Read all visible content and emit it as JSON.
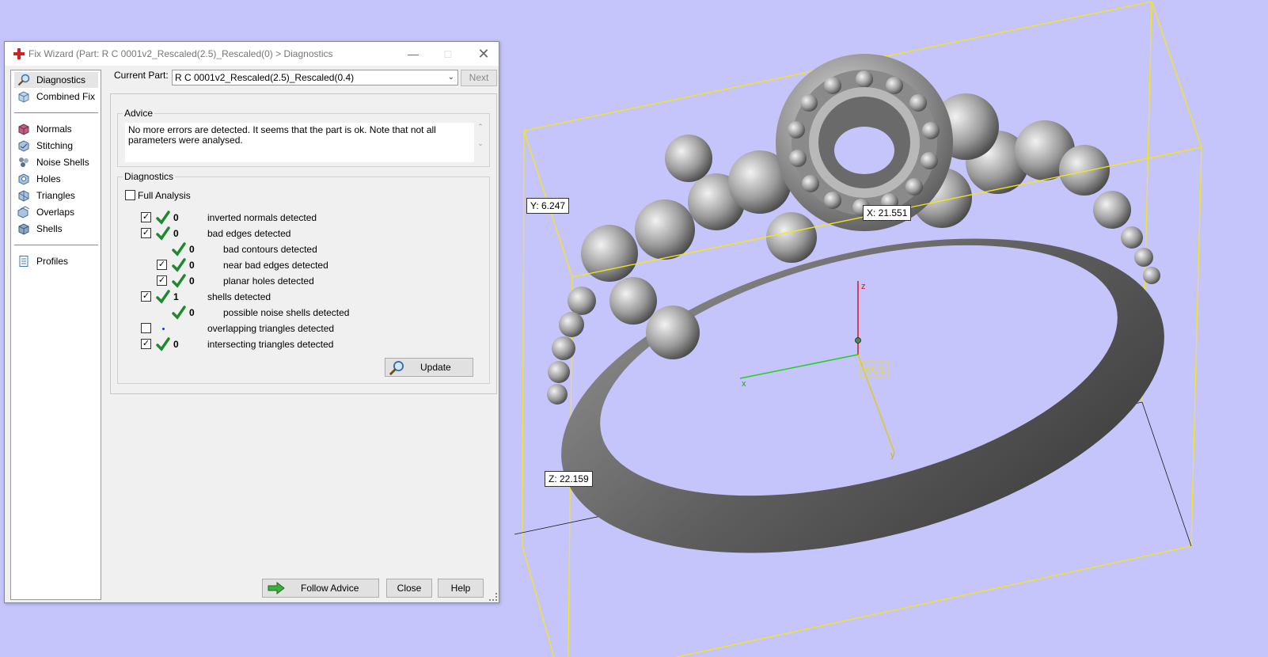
{
  "window": {
    "title": "Fix Wizard (Part: R C 0001v2_Rescaled(2.5)_Rescaled(0) > Diagnostics",
    "minimize_icon": "minimize-icon",
    "maximize_icon": "maximize-icon",
    "close_icon": "close-icon"
  },
  "sidebar": {
    "items": [
      {
        "label": "Diagnostics",
        "icon": "magnifier-icon",
        "selected": true
      },
      {
        "label": "Combined Fix",
        "icon": "cube-icon"
      },
      {
        "label": "Normals",
        "icon": "normals-cube-icon"
      },
      {
        "label": "Stitching",
        "icon": "stitching-icon"
      },
      {
        "label": "Noise Shells",
        "icon": "noise-shells-icon"
      },
      {
        "label": "Holes",
        "icon": "holes-icon"
      },
      {
        "label": "Triangles",
        "icon": "triangles-icon"
      },
      {
        "label": "Overlaps",
        "icon": "overlaps-icon"
      },
      {
        "label": "Shells",
        "icon": "shells-icon"
      },
      {
        "label": "Profiles",
        "icon": "document-icon"
      }
    ]
  },
  "header": {
    "current_part_label": "Current Part:",
    "current_part_value": "R C 0001v2_Rescaled(2.5)_Rescaled(0.4)",
    "next_label": "Next"
  },
  "advice": {
    "title": "Advice",
    "text": "No more errors are detected. It seems that the part is ok. Note that not all parameters were analysed."
  },
  "diagnostics": {
    "title": "Diagnostics",
    "full_analysis_label": "Full Analysis",
    "full_analysis_checked": false,
    "rows": [
      {
        "checked": true,
        "count": "0",
        "label": "inverted normals detected",
        "status": "ok"
      },
      {
        "checked": true,
        "count": "0",
        "label": "bad edges detected",
        "status": "ok"
      },
      {
        "checked": null,
        "count": "0",
        "label": "bad contours detected",
        "status": "ok"
      },
      {
        "checked": true,
        "count": "0",
        "label": "near bad edges detected",
        "status": "ok"
      },
      {
        "checked": true,
        "count": "0",
        "label": "planar holes detected",
        "status": "ok"
      },
      {
        "checked": true,
        "count": "1",
        "label": "shells detected",
        "status": "ok"
      },
      {
        "checked": null,
        "count": "0",
        "label": "possible noise shells detected",
        "status": "ok"
      },
      {
        "checked": false,
        "count": "",
        "label": "overlapping triangles detected",
        "status": "pending"
      },
      {
        "checked": true,
        "count": "0",
        "label": "intersecting triangles detected",
        "status": "ok"
      }
    ],
    "update_label": "Update"
  },
  "footer": {
    "follow_advice_label": "Follow Advice",
    "close_label": "Close",
    "help_label": "Help"
  },
  "viewport": {
    "x_dim_label": "X: 21.551",
    "y_dim_label": "Y: 6.247",
    "z_dim_label": "Z: 22.159",
    "axis_z": "z",
    "axis_x": "x",
    "axis_y": "y",
    "wcs_label": "WCS"
  },
  "colors": {
    "background": "#c5c5fb",
    "bounding_box": "#f5e61a",
    "check_green": "#1e8a2e",
    "axis_red": "#d01818",
    "axis_green": "#20d020"
  }
}
